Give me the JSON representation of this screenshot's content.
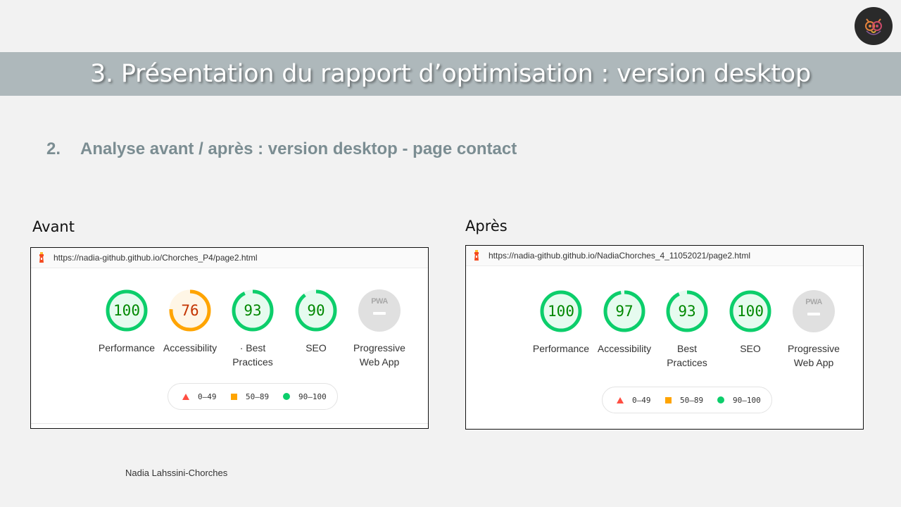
{
  "slide": {
    "title": "3. Présentation du rapport d’optimisation : version desktop",
    "subtitle_number": "2.",
    "subtitle_text": "Analyse avant / après :  version desktop - page contact",
    "footer": "Nadia Lahssini-Chorches",
    "logo_icon": "owl-logo-icon"
  },
  "colors": {
    "good": "#0cce6b",
    "good_text": "#008800",
    "good_fill": "#e6fbef",
    "average": "#ffa400",
    "average_text": "#c33300",
    "average_fill": "#fff6e6",
    "fail": "#ff4e42",
    "pwa_gray": "#e0e0e0",
    "title_band": "#aeb8bb",
    "subtitle": "#7b8d92"
  },
  "reports": [
    {
      "label": "Avant",
      "url": "https://nadia-github.github.io/Chorches_P4/page2.html",
      "gauges": [
        {
          "name": "Performance",
          "score": "100",
          "value": 100,
          "rating": "good"
        },
        {
          "name": "Accessibility",
          "score": "76",
          "value": 76,
          "rating": "average"
        },
        {
          "name": "· Best\nPractices",
          "score": "93",
          "value": 93,
          "rating": "good"
        },
        {
          "name": "SEO",
          "score": "90",
          "value": 90,
          "rating": "good"
        }
      ],
      "pwa": {
        "name": "Progressive\nWeb App",
        "badge": "PWA"
      },
      "legend": [
        "0–49",
        "50–89",
        "90–100"
      ]
    },
    {
      "label": "Après",
      "url": "https://nadia-github.github.io/NadiaChorches_4_11052021/page2.html",
      "gauges": [
        {
          "name": "Performance",
          "score": "100",
          "value": 100,
          "rating": "good"
        },
        {
          "name": "Accessibility",
          "score": "97",
          "value": 97,
          "rating": "good"
        },
        {
          "name": "Best\nPractices",
          "score": "93",
          "value": 93,
          "rating": "good"
        },
        {
          "name": "SEO",
          "score": "100",
          "value": 100,
          "rating": "good"
        }
      ],
      "pwa": {
        "name": "Progressive\nWeb App",
        "badge": "PWA"
      },
      "legend": [
        "0–49",
        "50–89",
        "90–100"
      ]
    }
  ]
}
